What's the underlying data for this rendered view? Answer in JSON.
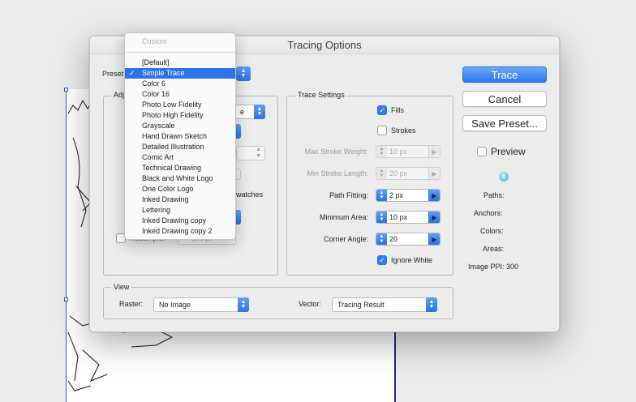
{
  "dialog": {
    "title": "Tracing Options",
    "preset_label": "Preset:"
  },
  "adjustments": {
    "group_title": "Adj",
    "partial_mode_value": "e",
    "partial_swatches_label": "watches",
    "resample_label": "Resample:",
    "resample_value": "300 px"
  },
  "preset_menu": {
    "items": [
      {
        "label": "Custom",
        "enabled": false,
        "selected": false
      },
      {
        "label": "[Default]",
        "enabled": true,
        "selected": false
      },
      {
        "label": "Simple Trace",
        "enabled": true,
        "selected": true
      },
      {
        "label": "Color 6",
        "enabled": true,
        "selected": false
      },
      {
        "label": "Color 16",
        "enabled": true,
        "selected": false
      },
      {
        "label": "Photo Low Fidelity",
        "enabled": true,
        "selected": false
      },
      {
        "label": "Photo High Fidelity",
        "enabled": true,
        "selected": false
      },
      {
        "label": "Grayscale",
        "enabled": true,
        "selected": false
      },
      {
        "label": "Hand Drawn Sketch",
        "enabled": true,
        "selected": false
      },
      {
        "label": "Detailed Illustration",
        "enabled": true,
        "selected": false
      },
      {
        "label": "Comic Art",
        "enabled": true,
        "selected": false
      },
      {
        "label": "Technical Drawing",
        "enabled": true,
        "selected": false
      },
      {
        "label": "Black and White Logo",
        "enabled": true,
        "selected": false
      },
      {
        "label": "One Color Logo",
        "enabled": true,
        "selected": false
      },
      {
        "label": "Inked Drawing",
        "enabled": true,
        "selected": false
      },
      {
        "label": "Lettering",
        "enabled": true,
        "selected": false
      },
      {
        "label": "Inked Drawing copy",
        "enabled": true,
        "selected": false
      },
      {
        "label": "Inked Drawing copy 2",
        "enabled": true,
        "selected": false
      }
    ],
    "selected_check": "✓"
  },
  "trace_settings": {
    "group_title": "Trace Settings",
    "fills": {
      "label": "Fills",
      "checked": true
    },
    "strokes": {
      "label": "Strokes",
      "checked": false
    },
    "max_stroke_weight": {
      "label": "Max Stroke Weight:",
      "value": "10 px",
      "enabled": false
    },
    "min_stroke_length": {
      "label": "Min Stroke Length:",
      "value": "20 px",
      "enabled": false
    },
    "path_fitting": {
      "label": "Path Fitting:",
      "value": "2 px",
      "enabled": true
    },
    "minimum_area": {
      "label": "Minimum Area:",
      "value": "10 px",
      "enabled": true
    },
    "corner_angle": {
      "label": "Corner Angle:",
      "value": "20",
      "enabled": true
    },
    "ignore_white": {
      "label": "Ignore White",
      "checked": true
    }
  },
  "buttons": {
    "trace": "Trace",
    "cancel": "Cancel",
    "save_preset": "Save Preset..."
  },
  "preview": {
    "label": "Preview",
    "checked": false
  },
  "stats": {
    "paths_label": "Paths:",
    "anchors_label": "Anchors:",
    "colors_label": "Colors:",
    "areas_label": "Areas:",
    "image_ppi_label": "Image PPI:",
    "image_ppi_value": "300"
  },
  "view": {
    "group_title": "View",
    "raster_label": "Raster:",
    "raster_value": "No Image",
    "vector_label": "Vector:",
    "vector_value": "Tracing Result"
  },
  "colors": {
    "accent": "#2c73e6",
    "dialog_bg": "#ececec"
  }
}
